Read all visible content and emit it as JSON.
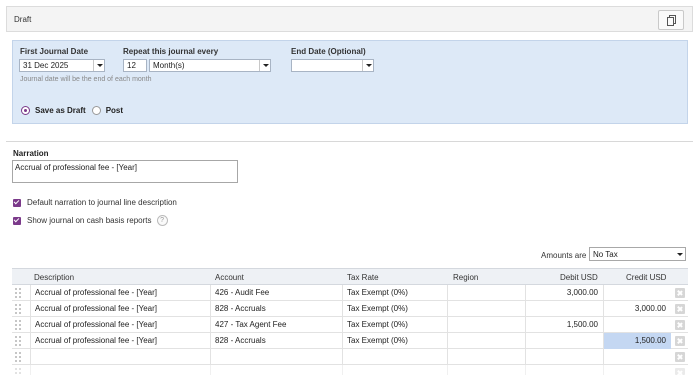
{
  "header": {
    "title": "Draft",
    "icon": "copy-icon"
  },
  "schedule": {
    "first_journal_label": "First Journal Date",
    "first_journal_value": "31 Dec 2025",
    "repeat_label": "Repeat this journal every",
    "repeat_count": "12",
    "repeat_unit": "Month(s)",
    "end_date_label": "End Date (Optional)",
    "end_date_value": "",
    "hint": "Journal date will be the end of each month",
    "save_as_draft_label": "Save as Draft",
    "post_label": "Post",
    "selected_option": "Save as Draft"
  },
  "narration": {
    "label": "Narration",
    "value": "Accrual of professional fee - [Year]"
  },
  "options": {
    "default_narration_label": "Default narration to journal line description",
    "default_narration_checked": true,
    "cash_basis_label": "Show journal on cash basis reports",
    "cash_basis_checked": true,
    "help_glyph": "?"
  },
  "amounts": {
    "label": "Amounts are",
    "value": "No Tax"
  },
  "table": {
    "headers": {
      "description": "Description",
      "account": "Account",
      "tax_rate": "Tax Rate",
      "region": "Region",
      "debit": "Debit USD",
      "credit": "Credit USD"
    },
    "rows": [
      {
        "description": "Accrual of professional fee - [Year]",
        "account": "426 - Audit Fee",
        "tax_rate": "Tax Exempt (0%)",
        "region": "",
        "debit": "3,000.00",
        "credit": ""
      },
      {
        "description": "Accrual of professional fee - [Year]",
        "account": "828 - Accruals",
        "tax_rate": "Tax Exempt (0%)",
        "region": "",
        "debit": "",
        "credit": "3,000.00"
      },
      {
        "description": "Accrual of professional fee - [Year]",
        "account": "427 - Tax Agent Fee",
        "tax_rate": "Tax Exempt (0%)",
        "region": "",
        "debit": "1,500.00",
        "credit": ""
      },
      {
        "description": "Accrual of professional fee - [Year]",
        "account": "828 - Accruals",
        "tax_rate": "Tax Exempt (0%)",
        "region": "",
        "debit": "",
        "credit": "1,500.00"
      }
    ]
  },
  "colors": {
    "accent": "#7b3a8a",
    "panel": "#dde9f7",
    "highlight": "#c4d7f2"
  }
}
